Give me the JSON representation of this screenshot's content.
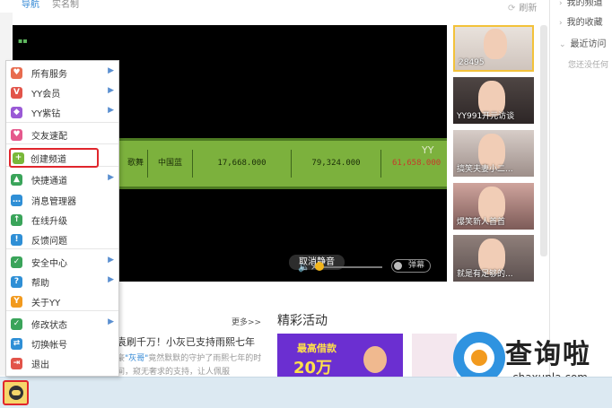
{
  "top_tabs": {
    "nav": "导航",
    "realname": "实名制",
    "refresh": "刷新"
  },
  "video": {
    "table_cells": [
      "歌舞",
      "中国蓝",
      "17,668.000",
      "79,324.000",
      "61,658.000"
    ],
    "yy_mark": "YY",
    "mute_toast": "取消静音",
    "volume_level": 0.02,
    "danmu_label": "弹幕"
  },
  "thumbnails": [
    {
      "caption": "28495",
      "active": true
    },
    {
      "caption": "YY991开元访谈",
      "active": false
    },
    {
      "caption": "搞笑夫妻小二...",
      "active": false
    },
    {
      "caption": "爆笑新人首首",
      "active": false
    },
    {
      "caption": "就是有足够的...",
      "active": false
    }
  ],
  "right_panel": {
    "items": [
      "我的频道",
      "我的收藏",
      "最近访问"
    ],
    "note": "您还没任何"
  },
  "content": {
    "more_link": "更多>>",
    "activity_title": "精彩活动",
    "news_title": "袁刷千万！小灰已支持雨熙七年",
    "news_desc_prefix": "豪",
    "news_desc_highlight": "\"灰哥\"",
    "news_desc_rest": "竟然默默的守护了雨熙七年的时间，窥无奢求的支持，让人佩服",
    "banner_line1": "最高借款",
    "banner_line2": "20万"
  },
  "watermark": {
    "brand": "查询啦",
    "domain": "chaxunla.com"
  },
  "menu": {
    "items": [
      {
        "label": "所有服务",
        "icon": "heart-icon",
        "color": "#e86c4f",
        "glyph": "♥",
        "sub": true
      },
      {
        "label": "YY会员",
        "icon": "vip-icon",
        "color": "#e2544a",
        "glyph": "V",
        "sub": true
      },
      {
        "label": "YY紫钻",
        "icon": "diamond-icon",
        "color": "#9a5ad6",
        "glyph": "◆",
        "sub": true
      },
      {
        "label": "交友速配",
        "icon": "match-icon",
        "color": "#e5598d",
        "glyph": "♥",
        "sub": false
      },
      {
        "label": "创建频道",
        "icon": "create-channel-icon",
        "color": "#79b83a",
        "glyph": "+",
        "sub": false
      },
      {
        "label": "快捷通道",
        "icon": "shortcut-icon",
        "color": "#3aa45a",
        "glyph": "▲",
        "sub": true
      },
      {
        "label": "消息管理器",
        "icon": "message-icon",
        "color": "#2f8fd6",
        "glyph": "…",
        "sub": false
      },
      {
        "label": "在线升级",
        "icon": "upgrade-icon",
        "color": "#3aa45a",
        "glyph": "↑",
        "sub": false
      },
      {
        "label": "反馈问题",
        "icon": "feedback-icon",
        "color": "#2f8fd6",
        "glyph": "!",
        "sub": false
      },
      {
        "label": "安全中心",
        "icon": "shield-icon",
        "color": "#3aa45a",
        "glyph": "✓",
        "sub": true
      },
      {
        "label": "帮助",
        "icon": "help-icon",
        "color": "#2f8fd6",
        "glyph": "?",
        "sub": true
      },
      {
        "label": "关于YY",
        "icon": "about-icon",
        "color": "#f29a1e",
        "glyph": "Y",
        "sub": false
      },
      {
        "label": "修改状态",
        "icon": "status-icon",
        "color": "#3aa45a",
        "glyph": "✓",
        "sub": true
      },
      {
        "label": "切换帐号",
        "icon": "switch-account-icon",
        "color": "#2f8fd6",
        "glyph": "⇄",
        "sub": false
      },
      {
        "label": "退出",
        "icon": "exit-icon",
        "color": "#e2544a",
        "glyph": "⇥",
        "sub": false
      }
    ]
  }
}
